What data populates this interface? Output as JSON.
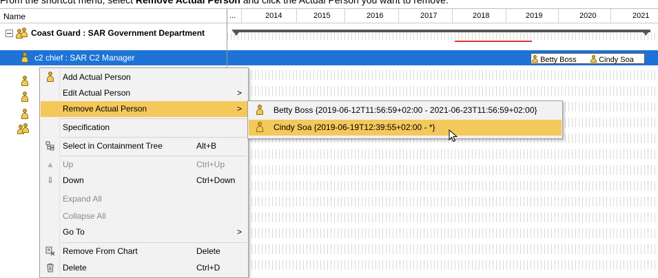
{
  "caption": {
    "pre": "From the shortcut menu, select ",
    "bold": "Remove Actual Person",
    "post": " and click the Actual Person you want to remove."
  },
  "tree": {
    "header": "Name",
    "rows": [
      {
        "label": "Coast Guard : SAR Government Department",
        "icon": "organization-icon",
        "bold": true,
        "expanded": true
      },
      {
        "label": "c2 chief : SAR C2 Manager",
        "icon": "person-icon",
        "selected": true
      }
    ]
  },
  "timeline": {
    "header_ellipsis": "...",
    "years": [
      "2014",
      "2015",
      "2016",
      "2017",
      "2018",
      "2019",
      "2020",
      "2021"
    ],
    "chips": [
      "Betty Boss",
      "Cindy Soa"
    ]
  },
  "menu": {
    "items": [
      {
        "label": "Add Actual Person",
        "icon": "person-icon"
      },
      {
        "label": "Edit Actual Person",
        "submenu": true
      },
      {
        "label": "Remove Actual Person",
        "submenu": true,
        "highlighted": true
      },
      {
        "label": "Specification"
      },
      {
        "label": "Select in Containment Tree",
        "shortcut": "Alt+B",
        "icon": "containment-tree-icon"
      },
      {
        "label": "Up",
        "shortcut": "Ctrl+Up",
        "disabled": true,
        "icon": "up-arrow-icon"
      },
      {
        "label": "Down",
        "shortcut": "Ctrl+Down",
        "icon": "down-arrow-icon"
      },
      {
        "label": "Expand All",
        "disabled": true
      },
      {
        "label": "Collapse All",
        "disabled": true
      },
      {
        "label": "Go To",
        "submenu": true
      },
      {
        "label": "Remove From Chart",
        "shortcut": "Delete",
        "icon": "remove-from-chart-icon"
      },
      {
        "label": "Delete",
        "shortcut": "Ctrl+D",
        "icon": "trash-icon"
      }
    ],
    "submenu_arrow": ">"
  },
  "submenu": {
    "items": [
      {
        "label": "Betty Boss {2019-06-12T11:56:59+02:00 - 2021-06-23T11:56:59+02:00}"
      },
      {
        "label": "Cindy Soa {2019-06-19T12:39:55+02:00 - *}",
        "highlighted": true
      }
    ]
  },
  "colors": {
    "selection": "#1e73d6",
    "menu_highlight": "#f5c85c",
    "menu_bg": "#f2f2f2",
    "today_marker": "#e03030"
  }
}
